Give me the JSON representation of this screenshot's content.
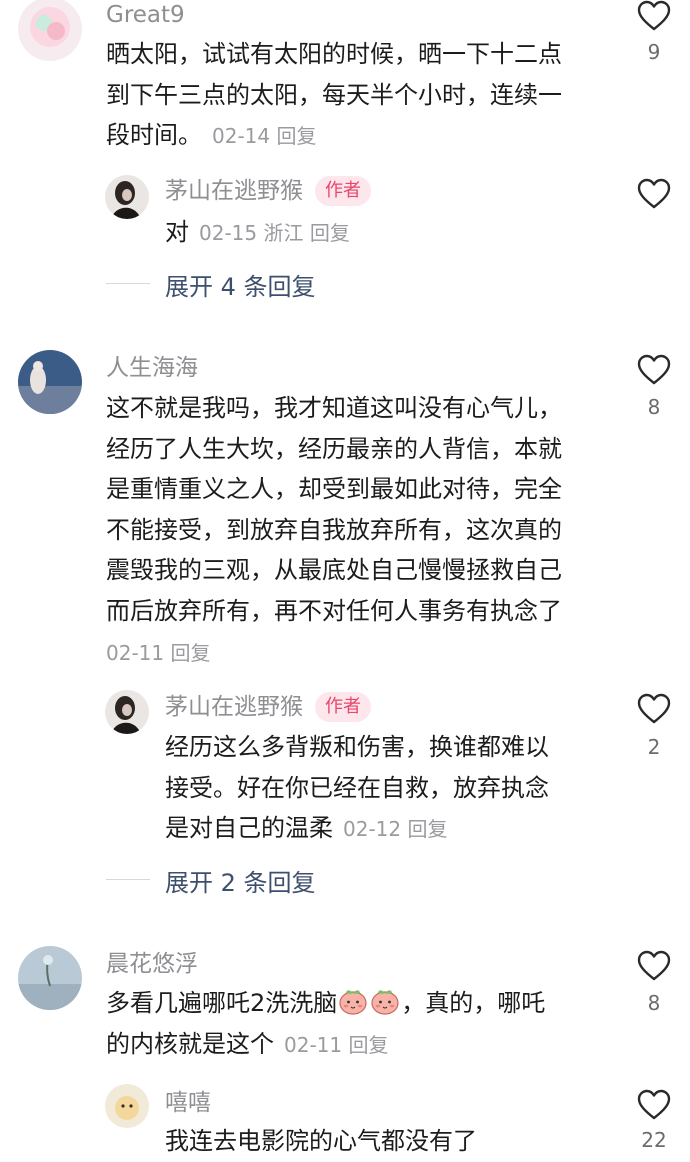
{
  "comments": [
    {
      "username": "Great9",
      "lines": [
        "晒太阳，试试有太阳的时候，晒一下十二点",
        "到下午三点的太阳，每天半个小时，连续一",
        "段时间。"
      ],
      "meta": "02-14 回复",
      "likes": "9",
      "reply": {
        "username": "茅山在逃野猴",
        "author_tag": "作者",
        "text": "对",
        "meta": "02-15 浙江 回复"
      },
      "expand": "展开 4 条回复"
    },
    {
      "username": "人生海海",
      "lines": [
        "这不就是我吗，我才知道这叫没有心气儿，",
        "经历了人生大坎，经历最亲的人背信，本就",
        "是重情重义之人，却受到最如此对待，完全",
        "不能接受，到放弃自我放弃所有，这次真的",
        "震毁我的三观，从最底处自己慢慢拯救自己",
        "而后放弃所有，再不对任何人事务有执念了"
      ],
      "meta": "02-11 回复",
      "likes": "8",
      "reply": {
        "username": "茅山在逃野猴",
        "author_tag": "作者",
        "lines": [
          "经历这么多背叛和伤害，换谁都难以",
          "接受。好在你已经在自救，放弃执念",
          "是对自己的温柔"
        ],
        "meta": "02-12 回复",
        "likes": "2"
      },
      "expand": "展开 2 条回复"
    },
    {
      "username": "晨花悠浮",
      "line1_text": "多看几遍哪吒2洗洗脑",
      "line1_tail": "，真的，哪吒",
      "line2_text": "的内核就是这个",
      "meta": "02-11 回复",
      "likes": "8",
      "emoji": "peach-face-emoji"
    },
    {
      "username": "嘻嘻",
      "text": "我连去电影院的心气都没有了",
      "likes": "22"
    }
  ],
  "colors": {
    "author_tag": "#e8466b",
    "expand_link": "#3d4f6d",
    "meta": "#9a9a9f"
  }
}
